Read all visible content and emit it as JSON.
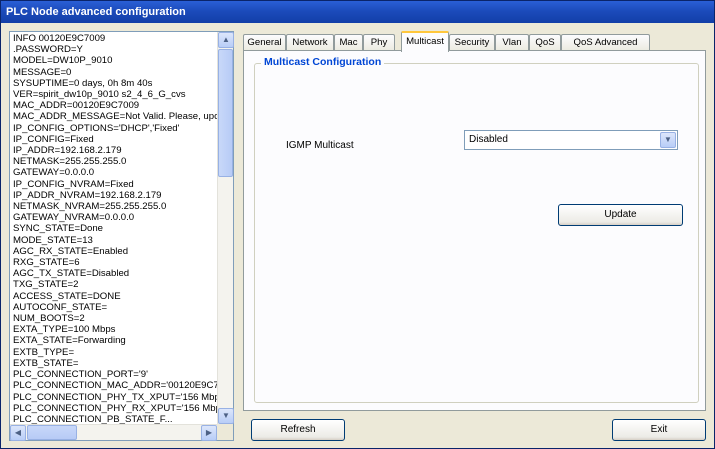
{
  "window": {
    "title": "PLC Node advanced configuration"
  },
  "log": {
    "lines": [
      "INFO 00120E9C7009",
      ".PASSWORD=Y",
      "MODEL=DW10P_9010",
      "MESSAGE=0",
      "SYSUPTIME=0 days, 0h 8m 40s",
      "VER=spirit_dw10p_9010 s2_4_6_G_cvs",
      "MAC_ADDR=00120E9C7009",
      "MAC_ADDR_MESSAGE=Not Valid. Please, upc",
      "IP_CONFIG_OPTIONS='DHCP','Fixed'",
      "IP_CONFIG=Fixed",
      "IP_ADDR=192.168.2.179",
      "NETMASK=255.255.255.0",
      "GATEWAY=0.0.0.0",
      "IP_CONFIG_NVRAM=Fixed",
      "IP_ADDR_NVRAM=192.168.2.179",
      "NETMASK_NVRAM=255.255.255.0",
      "GATEWAY_NVRAM=0.0.0.0",
      "SYNC_STATE=Done",
      "MODE_STATE=13",
      "AGC_RX_STATE=Enabled",
      "RXG_STATE=6",
      "AGC_TX_STATE=Disabled",
      "TXG_STATE=2",
      "ACCESS_STATE=DONE",
      "AUTOCONF_STATE=",
      "NUM_BOOTS=2",
      "EXTA_TYPE=100 Mbps",
      "EXTA_STATE=Forwarding",
      "EXTB_TYPE=",
      "EXTB_STATE=",
      "PLC_CONNECTION_PORT='9'",
      "PLC_CONNECTION_MAC_ADDR='00120E9C7",
      "PLC_CONNECTION_PHY_TX_XPUT='156 Mbp",
      "PLC_CONNECTION_PHY_RX_XPUT='156 Mbp",
      "PLC_CONNECTION_PB_STATE_F..."
    ]
  },
  "tabs": [
    "General",
    "Network",
    "Mac",
    "Phy",
    "Multicast",
    "Security",
    "Vlan",
    "QoS",
    "QoS Advanced"
  ],
  "active_tab": "Multicast",
  "multicast": {
    "group_title": "Multicast Configuration",
    "igmp_label": "IGMP Multicast",
    "igmp_value": "Disabled",
    "update_label": "Update"
  },
  "footer": {
    "refresh_label": "Refresh",
    "exit_label": "Exit"
  },
  "icons": {
    "scroll_up": "▲",
    "scroll_down": "▼",
    "scroll_left": "◀",
    "scroll_right": "▶",
    "dropdown": "▼"
  },
  "colors": {
    "titlebar": "#1c4bbb",
    "active_tab_highlight": "#ffc73c",
    "group_title": "#0046d5"
  }
}
